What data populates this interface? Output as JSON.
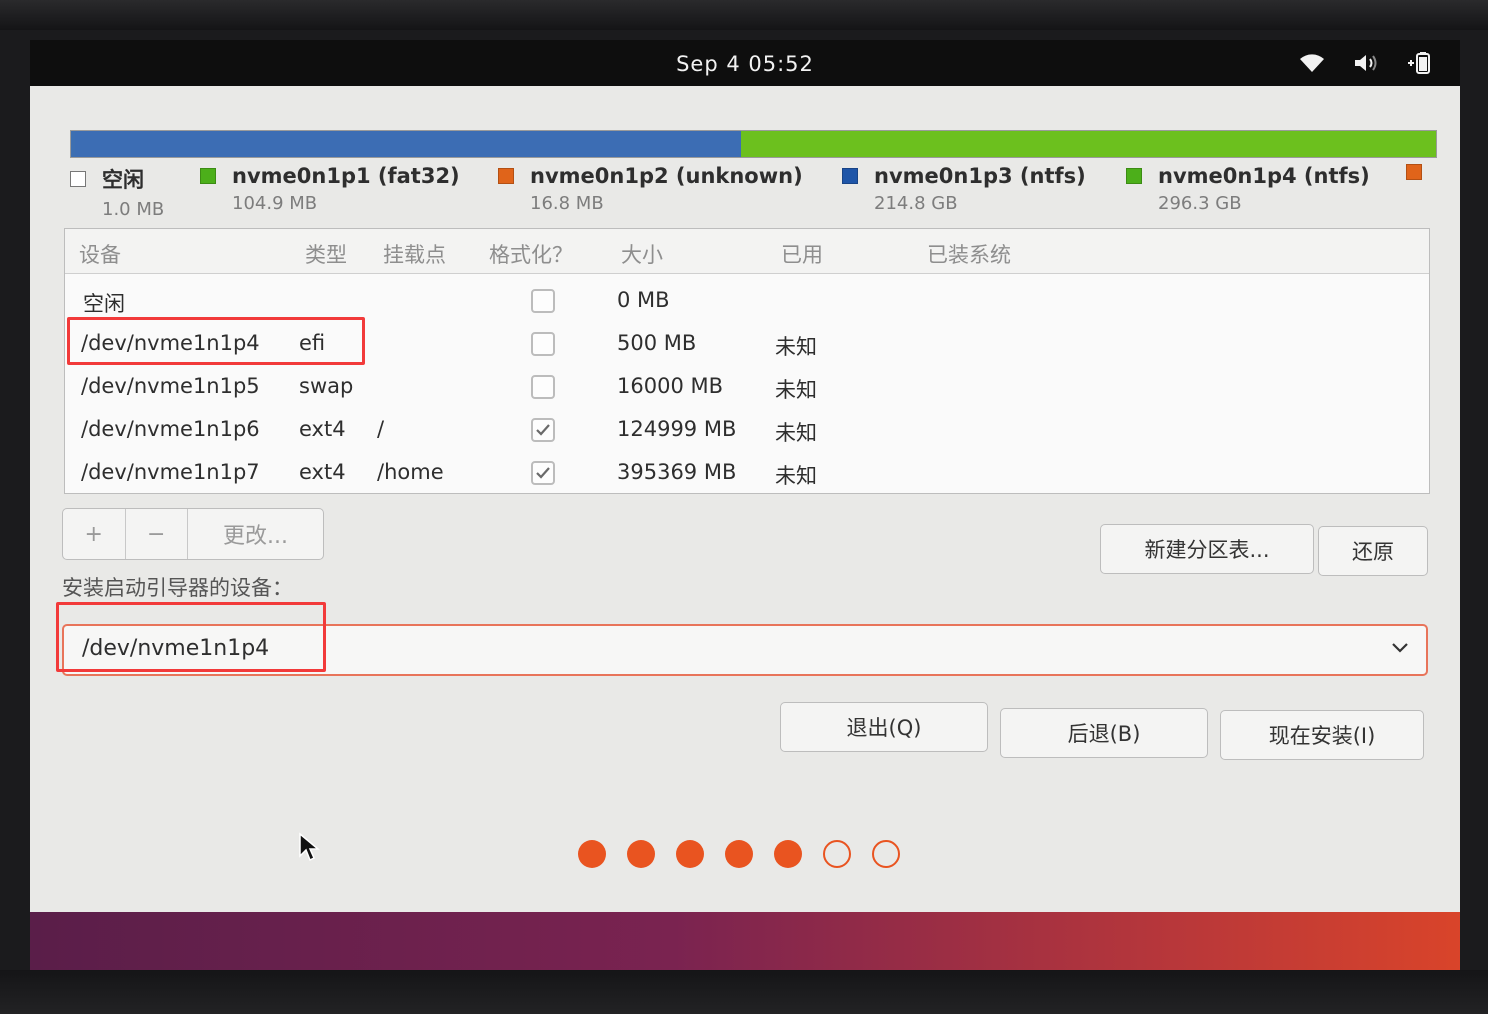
{
  "topbar": {
    "clock": "Sep 4  05:52",
    "icons": [
      "wifi-icon",
      "volume-icon",
      "battery-icon"
    ]
  },
  "partition_bar": {
    "segments": [
      {
        "name": "空闲",
        "fraction": 0.0,
        "color": "#ffffff"
      },
      {
        "name": "nvme0n1p1 (fat32)",
        "fraction": 0.002,
        "color": "#3d6fb2"
      },
      {
        "name": "nvme0n1p2 (unknown)",
        "fraction": 0.001,
        "color": "#3d6fb2"
      },
      {
        "name": "nvme0n1p3 (ntfs)",
        "fraction": 0.488,
        "color": "#3c6db4"
      },
      {
        "name": "nvme0n1p4 (ntfs)",
        "fraction": 0.509,
        "color": "#6cc01e"
      }
    ]
  },
  "legend": [
    {
      "name": "空闲",
      "size": "1.0 MB",
      "color": "#ffffff"
    },
    {
      "name": "nvme0n1p1 (fat32)",
      "size": "104.9 MB",
      "color": "#4caf1a"
    },
    {
      "name": "nvme0n1p2 (unknown)",
      "size": "16.8 MB",
      "color": "#e0641a"
    },
    {
      "name": "nvme0n1p3 (ntfs)",
      "size": "214.8 GB",
      "color": "#1e55a8"
    },
    {
      "name": "nvme0n1p4 (ntfs)",
      "size": "296.3 GB",
      "color": "#4caf1a"
    },
    {
      "name": "",
      "size": "",
      "color": "#e0641a"
    }
  ],
  "table": {
    "headers": [
      "设备",
      "类型",
      "挂载点",
      "格式化？",
      "大小",
      "已用",
      "已装系统"
    ],
    "rows": [
      {
        "device": "空闲",
        "type": "",
        "mount": "",
        "format": false,
        "size": "0 MB",
        "used": "",
        "system": ""
      },
      {
        "device": "/dev/nvme1n1p4",
        "type": "efi",
        "mount": "",
        "format": false,
        "size": "500 MB",
        "used": "未知",
        "system": ""
      },
      {
        "device": "/dev/nvme1n1p5",
        "type": "swap",
        "mount": "",
        "format": false,
        "size": "16000 MB",
        "used": "未知",
        "system": ""
      },
      {
        "device": "/dev/nvme1n1p6",
        "type": "ext4",
        "mount": "/",
        "format": true,
        "size": "124999 MB",
        "used": "未知",
        "system": ""
      },
      {
        "device": "/dev/nvme1n1p7",
        "type": "ext4",
        "mount": "/home",
        "format": true,
        "size": "395369 MB",
        "used": "未知",
        "system": ""
      }
    ]
  },
  "partition_buttons": {
    "add": "+",
    "remove": "−",
    "change": "更改..."
  },
  "new_table_button": "新建分区表...",
  "revert_button": "还原",
  "boot_loader": {
    "label": "安装启动引导器的设备：",
    "value": "/dev/nvme1n1p4"
  },
  "actions": {
    "quit": "退出(Q)",
    "back": "后退(B)",
    "install": "现在安装(I)"
  },
  "progress": {
    "current_step": 5,
    "total_steps": 7
  }
}
